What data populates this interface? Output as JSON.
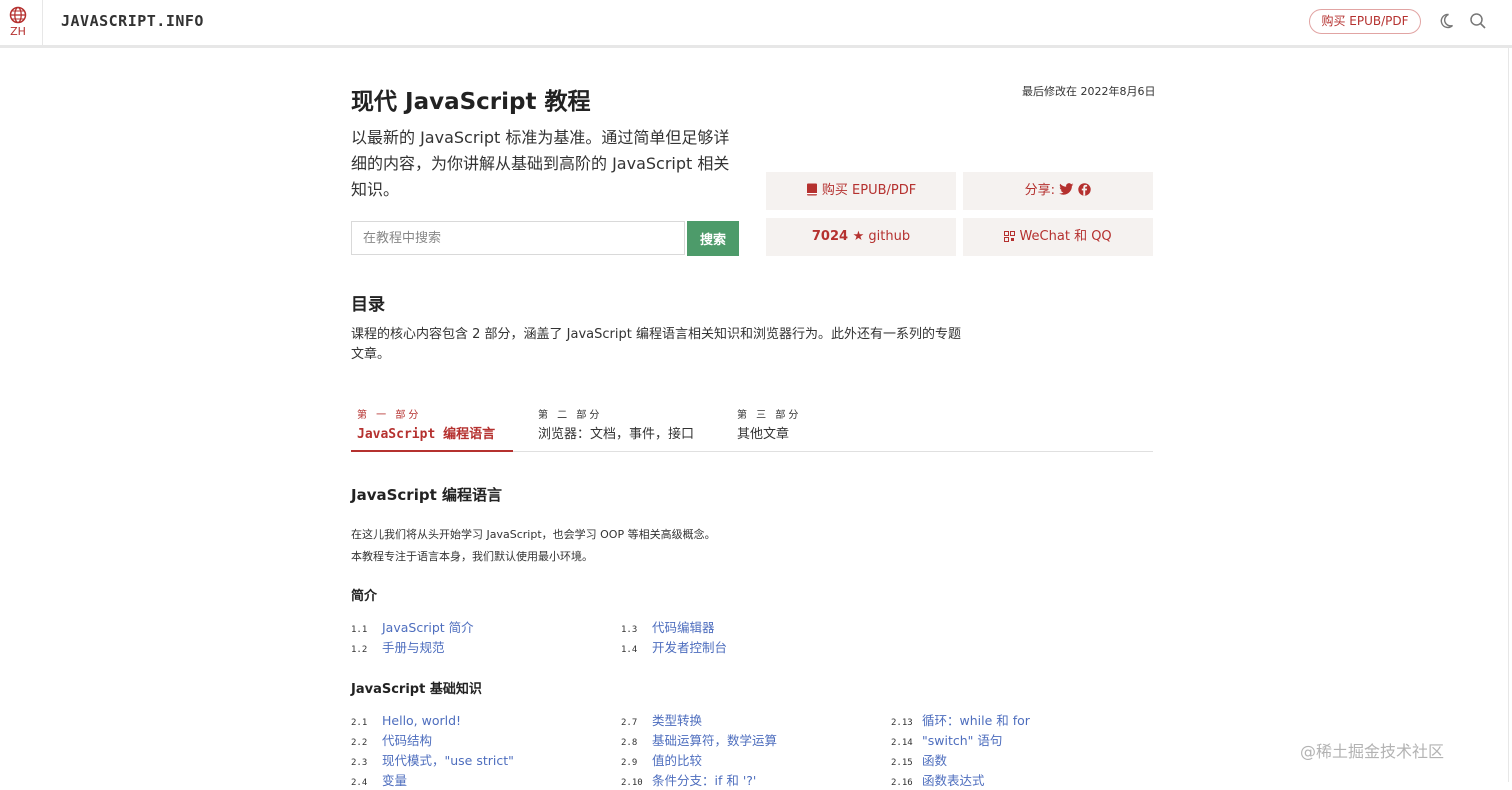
{
  "header": {
    "lang_code": "ZH",
    "logo": "JAVASCRIPT.INFO",
    "buy_label": "购买 EPUB/PDF"
  },
  "intro": {
    "title": "现代 JavaScript 教程",
    "modified": "最后修改在 2022年8月6日",
    "lead": "以最新的 JavaScript 标准为基准。通过简单但足够详细的内容，为你讲解从基础到高阶的 JavaScript 相关知识。",
    "search_placeholder": "在教程中搜索",
    "search_button": "搜索"
  },
  "cards": {
    "buy": "购买 EPUB/PDF",
    "share": "分享:",
    "github_count": "7024 ★",
    "github": "github",
    "wechat": "WeChat 和 QQ"
  },
  "toc": {
    "title": "目录",
    "desc": "课程的核心内容包含 2 部分，涵盖了 JavaScript 编程语言相关知识和浏览器行为。此外还有一系列的专题文章。",
    "tabs": [
      {
        "small": "第 一 部分",
        "big": "JavaScript 编程语言"
      },
      {
        "small": "第 二 部分",
        "big": "浏览器：文档，事件，接口"
      },
      {
        "small": "第 三 部分",
        "big": "其他文章"
      }
    ]
  },
  "part1": {
    "title": "JavaScript 编程语言",
    "desc1": "在这儿我们将从头开始学习 JavaScript，也会学习 OOP 等相关高级概念。",
    "desc2": "本教程专注于语言本身，我们默认使用最小环境。",
    "sections": [
      {
        "title": "简介",
        "items": [
          {
            "num": "1.1",
            "label": "JavaScript 简介"
          },
          {
            "num": "1.2",
            "label": "手册与规范"
          },
          {
            "num": "1.3",
            "label": "代码编辑器"
          },
          {
            "num": "1.4",
            "label": "开发者控制台"
          }
        ]
      },
      {
        "title": "JavaScript 基础知识",
        "items": [
          {
            "num": "2.1",
            "label": "Hello, world!"
          },
          {
            "num": "2.2",
            "label": "代码结构"
          },
          {
            "num": "2.3",
            "label": "现代模式，\"use strict\""
          },
          {
            "num": "2.4",
            "label": "变量"
          },
          {
            "num": "2.7",
            "label": "类型转换"
          },
          {
            "num": "2.8",
            "label": "基础运算符，数学运算"
          },
          {
            "num": "2.9",
            "label": "值的比较"
          },
          {
            "num": "2.10",
            "label": "条件分支：if 和 '?'"
          },
          {
            "num": "2.13",
            "label": "循环：while 和 for"
          },
          {
            "num": "2.14",
            "label": "\"switch\" 语句"
          },
          {
            "num": "2.15",
            "label": "函数"
          },
          {
            "num": "2.16",
            "label": "函数表达式"
          }
        ]
      }
    ]
  },
  "watermark": "@稀土掘金技术社区",
  "colors": {
    "accent": "#b5312f",
    "link": "#4e6ebe",
    "search_button": "#4d9b6a",
    "card_bg": "#f5f2f0"
  }
}
